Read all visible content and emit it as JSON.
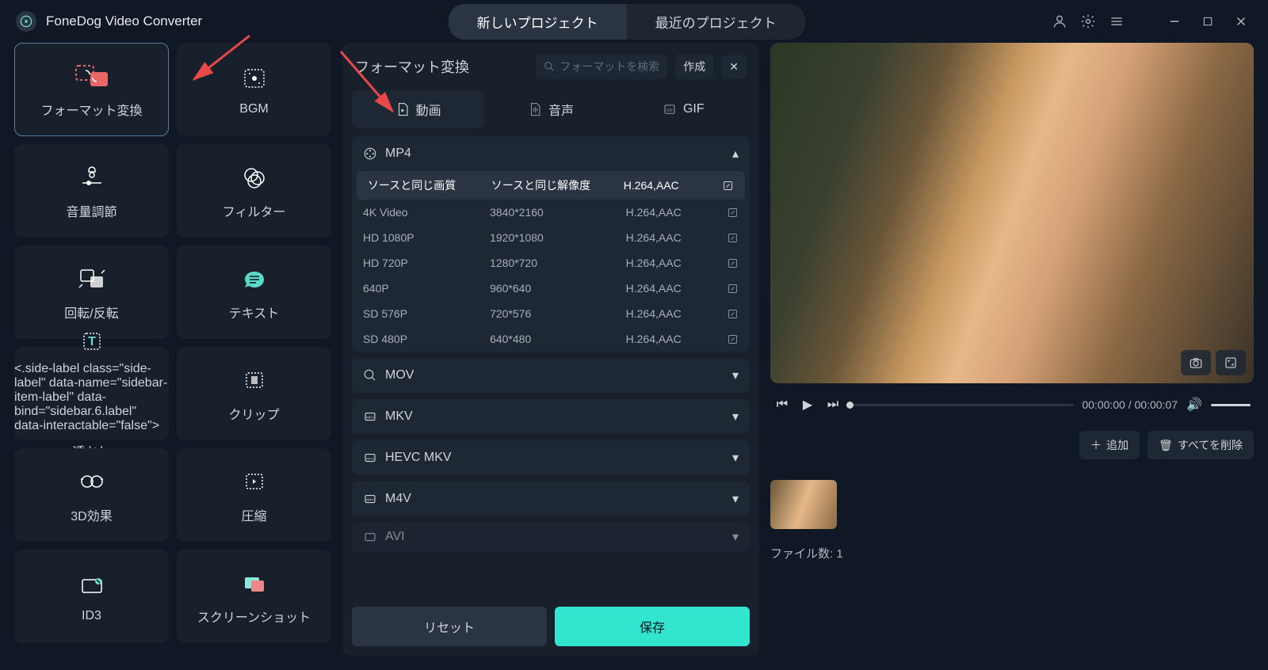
{
  "app": {
    "title": "FoneDog Video Converter"
  },
  "tabs": {
    "new_project": "新しいプロジェクト",
    "recent_project": "最近のプロジェクト"
  },
  "sidebar": [
    {
      "label": "フォーマット変換"
    },
    {
      "label": "BGM"
    },
    {
      "label": "音量調節"
    },
    {
      "label": "フィルター"
    },
    {
      "label": "回転/反転"
    },
    {
      "label": "テキスト"
    },
    {
      "label": "透かし"
    },
    {
      "label": "クリップ"
    },
    {
      "label": "3D効果"
    },
    {
      "label": "圧縮"
    },
    {
      "label": "ID3"
    },
    {
      "label": "スクリーンショット"
    }
  ],
  "center": {
    "title": "フォーマット変換",
    "search_placeholder": "フォーマットを検索",
    "create": "作成",
    "type_tabs": {
      "video": "動画",
      "audio": "音声",
      "gif": "GIF"
    },
    "mp4": {
      "name": "MP4",
      "rows": [
        {
          "q": "ソースと同じ画質",
          "res": "ソースと同じ解像度",
          "codec": "H.264,AAC"
        },
        {
          "q": "4K Video",
          "res": "3840*2160",
          "codec": "H.264,AAC"
        },
        {
          "q": "HD 1080P",
          "res": "1920*1080",
          "codec": "H.264,AAC"
        },
        {
          "q": "HD 720P",
          "res": "1280*720",
          "codec": "H.264,AAC"
        },
        {
          "q": "640P",
          "res": "960*640",
          "codec": "H.264,AAC"
        },
        {
          "q": "SD 576P",
          "res": "720*576",
          "codec": "H.264,AAC"
        },
        {
          "q": "SD 480P",
          "res": "640*480",
          "codec": "H.264,AAC"
        }
      ]
    },
    "groups": [
      "MOV",
      "MKV",
      "HEVC MKV",
      "M4V",
      "AVI"
    ],
    "reset": "リセット",
    "save": "保存"
  },
  "player": {
    "current": "00:00:00",
    "total": "00:00:07"
  },
  "files": {
    "add": "追加",
    "delete_all": "すべてを削除",
    "count_label": "ファイル数:",
    "count": "1"
  }
}
